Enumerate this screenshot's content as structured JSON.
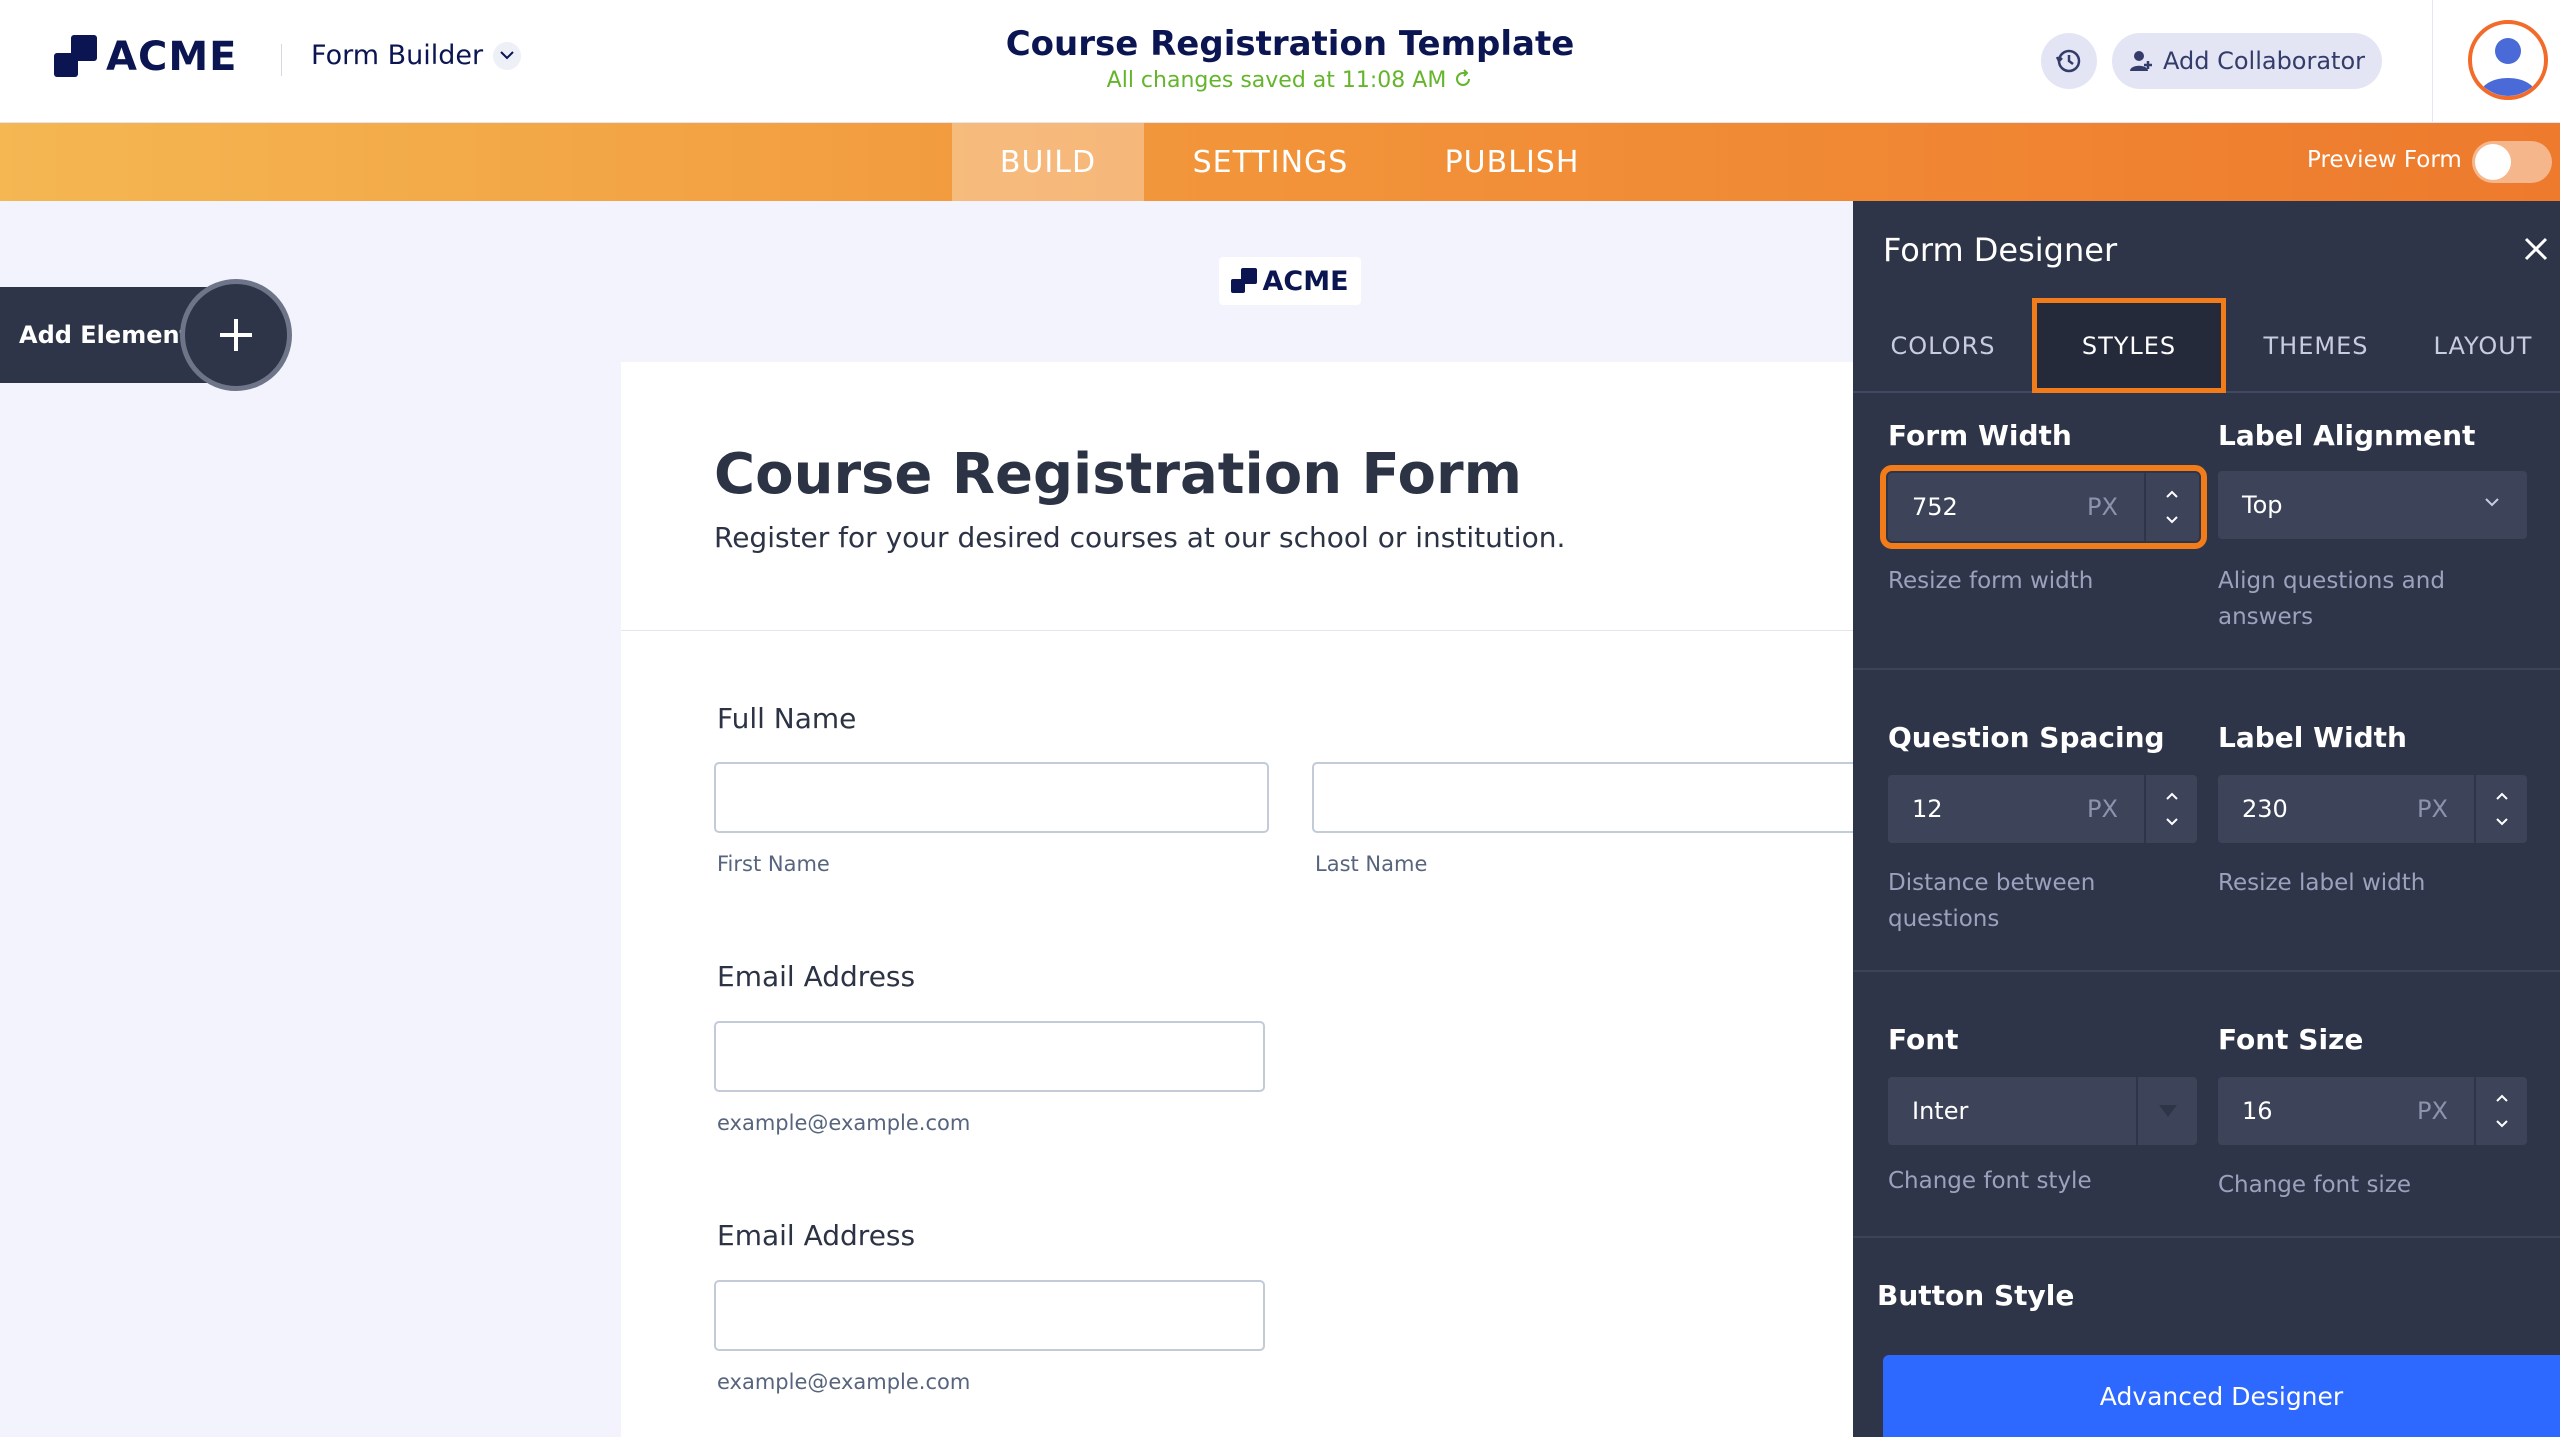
{
  "header": {
    "logo_text": "ACME",
    "builder_label": "Form Builder",
    "title": "Course Registration Template",
    "save_status": "All changes saved at 11:08 AM",
    "add_collaborator_label": "Add Collaborator"
  },
  "nav": {
    "tabs": [
      {
        "label": "BUILD",
        "active": true
      },
      {
        "label": "SETTINGS",
        "active": false
      },
      {
        "label": "PUBLISH",
        "active": false
      }
    ],
    "preview_label": "Preview Form",
    "preview_on": false
  },
  "canvas": {
    "add_element_label": "Add Element",
    "form_logo_text": "ACME",
    "form_title": "Course Registration Form",
    "form_description": "Register for your desired courses at our school or institution.",
    "questions": [
      {
        "label": "Full Name",
        "sublabels": [
          "First Name",
          "Last Name"
        ]
      },
      {
        "label": "Email Address",
        "sublabel": "example@example.com"
      },
      {
        "label": "Email Address",
        "sublabel": "example@example.com"
      }
    ]
  },
  "panel": {
    "title": "Form Designer",
    "tabs": [
      "COLORS",
      "STYLES",
      "THEMES",
      "LAYOUT"
    ],
    "active_tab": "STYLES",
    "form_width": {
      "label": "Form Width",
      "value": "752",
      "unit": "PX",
      "help": "Resize form width"
    },
    "label_alignment": {
      "label": "Label Alignment",
      "value": "Top",
      "help": "Align questions and answers"
    },
    "question_spacing": {
      "label": "Question Spacing",
      "value": "12",
      "unit": "PX",
      "help": "Distance between questions"
    },
    "label_width": {
      "label": "Label Width",
      "value": "230",
      "unit": "PX",
      "help": "Resize label width"
    },
    "font": {
      "label": "Font",
      "value": "Inter",
      "help": "Change font style"
    },
    "font_size": {
      "label": "Font Size",
      "value": "16",
      "unit": "PX",
      "help": "Change font size"
    },
    "button_style_label": "Button Style",
    "advanced_designer_label": "Advanced Designer"
  },
  "colors": {
    "accent_orange": "#f27b1a",
    "navy": "#0a1551",
    "panel_bg": "#2f3548",
    "save_green": "#64b52c",
    "primary_blue": "#2e69ff"
  }
}
